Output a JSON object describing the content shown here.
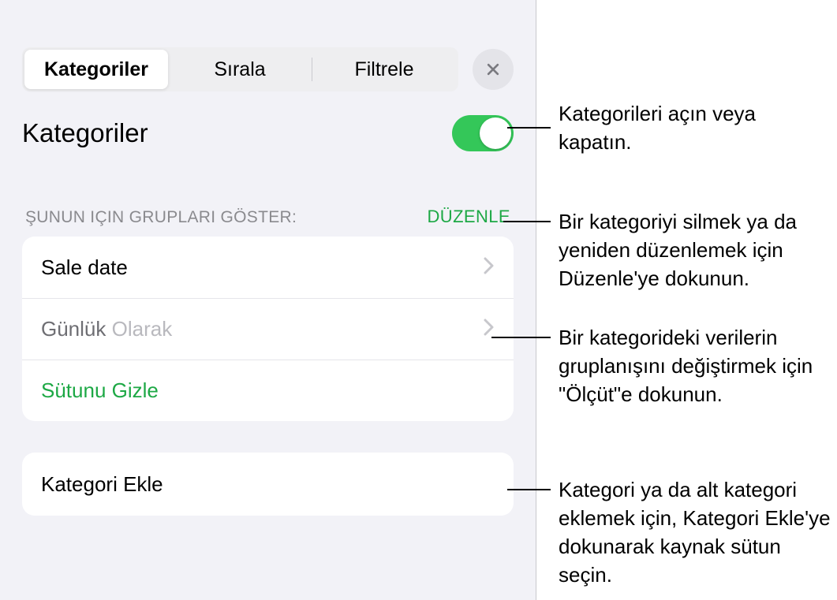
{
  "tabs": {
    "t1": "Kategoriler",
    "t2": "Sırala",
    "t3": "Filtrele"
  },
  "title": "Kategoriler",
  "section": {
    "label": "ŞUNUN IÇIN GRUPLARI GÖSTER:",
    "edit": "DÜZENLE"
  },
  "rows": {
    "r1": "Sale date",
    "r2a": "Günlük",
    "r2b": " Olarak",
    "r3": "Sütunu Gizle",
    "r4": "Kategori Ekle"
  },
  "callouts": {
    "c1": "Kategorileri açın veya kapatın.",
    "c2": "Bir kategoriyi silmek ya da yeniden düzenlemek için Düzenle'ye dokunun.",
    "c3": "Bir kategorideki verilerin gruplanışını değiştirmek için \"Ölçüt\"e dokunun.",
    "c4": "Kategori ya da alt kategori eklemek için, Kategori Ekle'ye dokunarak kaynak sütun seçin."
  }
}
